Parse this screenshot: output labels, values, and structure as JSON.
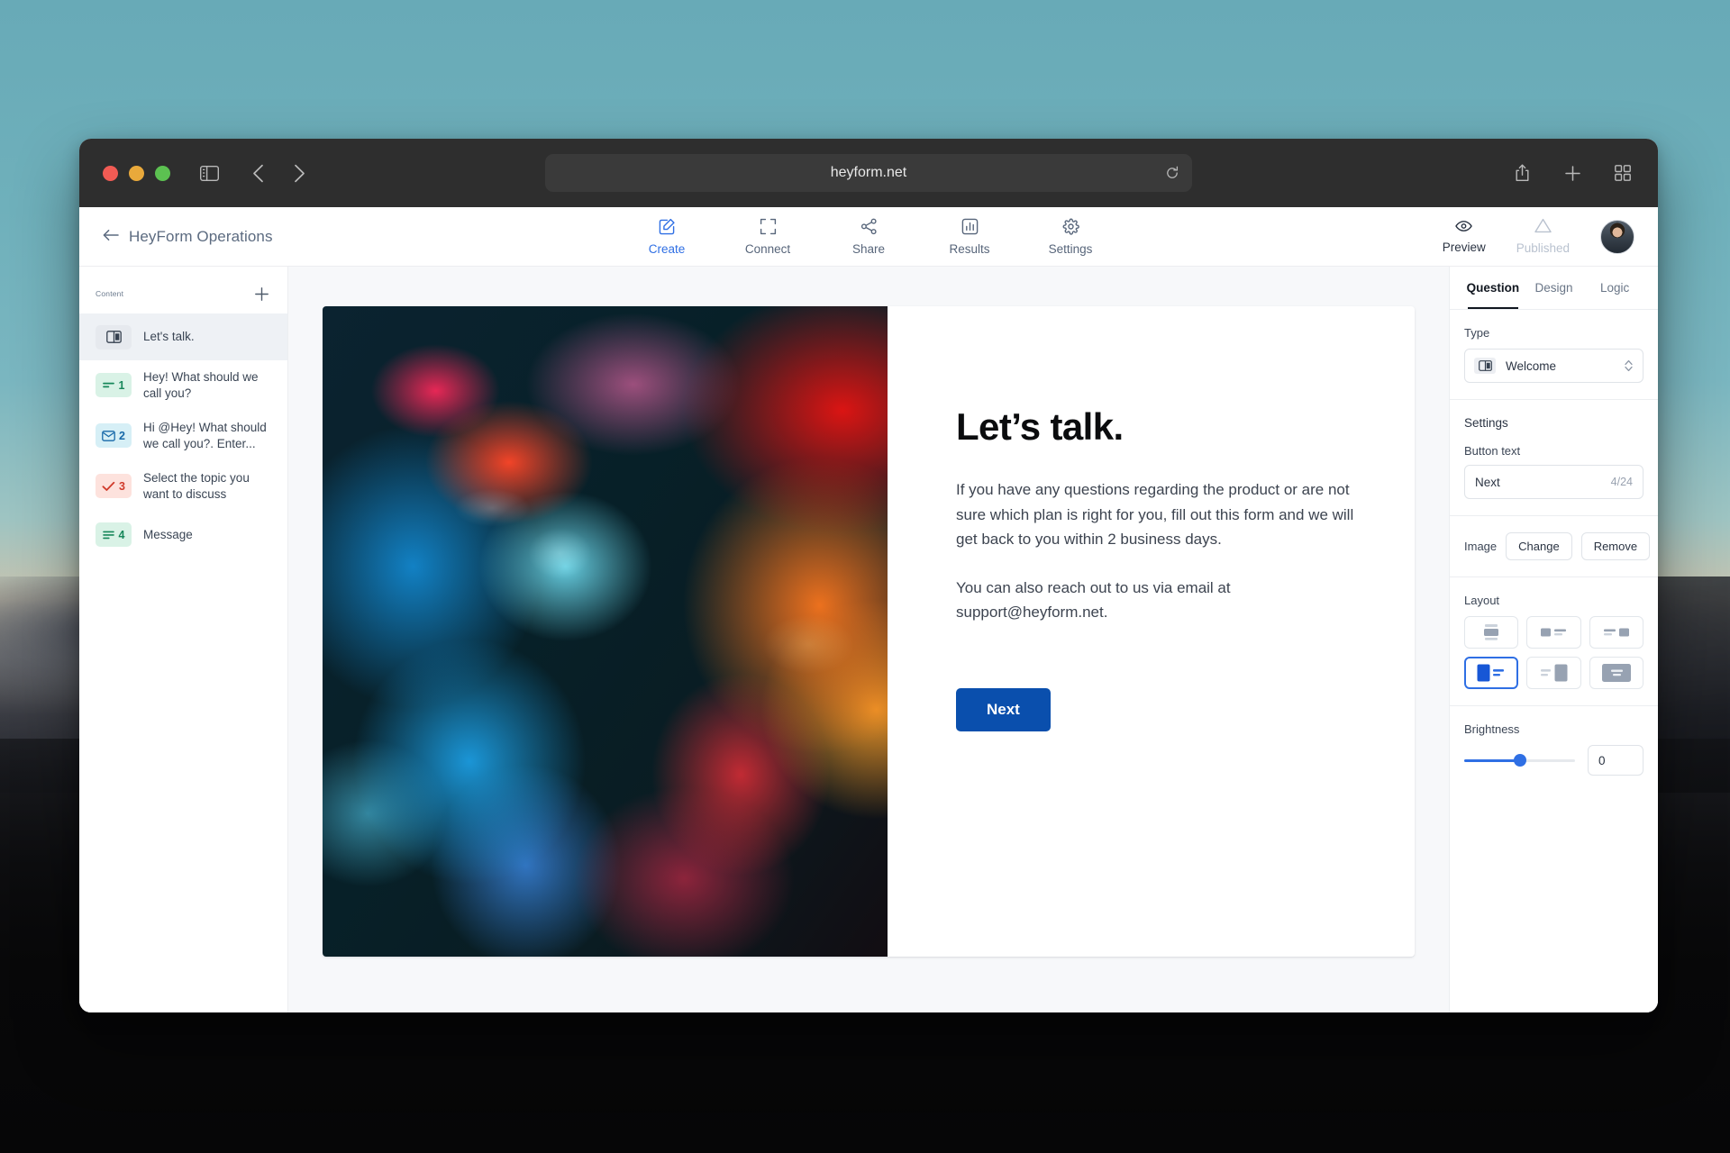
{
  "browser": {
    "url": "heyform.net",
    "traffic_lights": [
      "close-red",
      "minimize-yellow",
      "maximize-green"
    ],
    "icons": {
      "sidebar_toggle": "sidebar-toggle-icon",
      "back": "back-arrow-icon",
      "forward": "forward-arrow-icon",
      "reload": "reload-icon",
      "share": "share-icon",
      "new_tab": "plus-icon",
      "tab_overview": "tab-grid-icon"
    }
  },
  "header": {
    "back_icon": "back-arrow-icon",
    "breadcrumb": "HeyForm Operations",
    "nav_tabs": [
      {
        "label": "Create",
        "icon": "pencil-square-icon",
        "active": true
      },
      {
        "label": "Connect",
        "icon": "expand-icon",
        "active": false
      },
      {
        "label": "Share",
        "icon": "share-nodes-icon",
        "active": false
      },
      {
        "label": "Results",
        "icon": "bar-chart-icon",
        "active": false
      },
      {
        "label": "Settings",
        "icon": "gear-icon",
        "active": false
      }
    ],
    "preview": {
      "label": "Preview",
      "icon": "eye-icon"
    },
    "published": {
      "label": "Published",
      "icon": "warning-triangle-icon"
    },
    "avatar": "user-avatar"
  },
  "sidebar": {
    "title": "Content",
    "add_icon": "plus-icon",
    "items": [
      {
        "label": "Let's talk.",
        "badge": "",
        "kind": "welcome",
        "icon": "welcome-icon",
        "active": true
      },
      {
        "label": "Hey! What should we call you?",
        "badge": "1",
        "kind": "green",
        "icon": "short-text-icon",
        "active": false
      },
      {
        "label": "Hi @Hey! What should we call you?. Enter...",
        "badge": "2",
        "kind": "cyan",
        "icon": "email-icon",
        "active": false
      },
      {
        "label": "Select the topic you want to discuss",
        "badge": "3",
        "kind": "pink",
        "icon": "checkmark-icon",
        "active": false
      },
      {
        "label": "Message",
        "badge": "4",
        "kind": "green",
        "icon": "long-text-icon",
        "active": false
      }
    ]
  },
  "form": {
    "title": "Let’s talk.",
    "paragraph1": "If you have any questions regarding the product or are not sure which plan is right for you, fill out this form and we will get back to you within 2 business days.",
    "paragraph2": "You can also reach out to us via email at support@heyform.net.",
    "button_label": "Next",
    "button_color": "#0a4fad",
    "image_alt": "abstract-ink-in-water-blue-red"
  },
  "panel": {
    "tabs": [
      {
        "label": "Question",
        "active": true
      },
      {
        "label": "Design",
        "active": false
      },
      {
        "label": "Logic",
        "active": false
      }
    ],
    "type": {
      "label": "Type",
      "value": "Welcome",
      "icon": "welcome-icon",
      "chevron": "chevron-updown-icon"
    },
    "settings": {
      "title": "Settings",
      "button_text_label": "Button text",
      "button_text_value": "Next",
      "button_text_counter": "4/24"
    },
    "image": {
      "label": "Image",
      "change_label": "Change",
      "remove_label": "Remove"
    },
    "layout": {
      "label": "Layout",
      "options": [
        {
          "name": "layout-image-top-center",
          "selected": false
        },
        {
          "name": "layout-image-left-small",
          "selected": false
        },
        {
          "name": "layout-image-right-small",
          "selected": false
        },
        {
          "name": "layout-split-left",
          "selected": true
        },
        {
          "name": "layout-split-right",
          "selected": false
        },
        {
          "name": "layout-full-background",
          "selected": false
        }
      ]
    },
    "brightness": {
      "label": "Brightness",
      "value": "0",
      "percent": 50,
      "accent": "#2f6fe4"
    }
  }
}
